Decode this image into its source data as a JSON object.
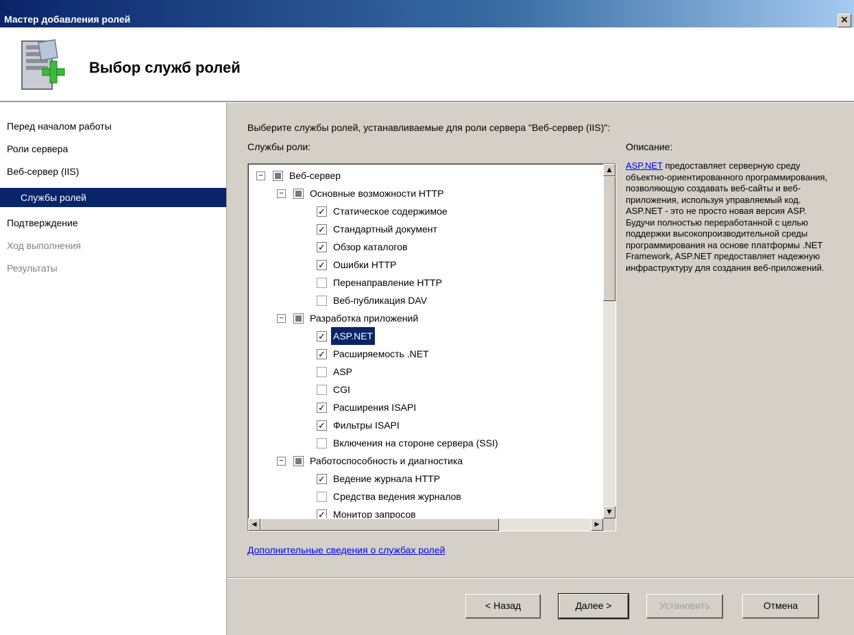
{
  "window": {
    "title": "Мастер добавления ролей",
    "close_label": "×"
  },
  "header": {
    "heading": "Выбор служб ролей"
  },
  "nav": {
    "items": [
      {
        "label": "Перед началом работы"
      },
      {
        "label": "Роли сервера"
      },
      {
        "label": "Веб-сервер (IIS)"
      },
      {
        "label": "Службы ролей"
      },
      {
        "label": "Подтверждение"
      },
      {
        "label": "Ход выполнения"
      },
      {
        "label": "Результаты"
      }
    ]
  },
  "main": {
    "instruction": "Выберите службы ролей, устанавливаемые для роли сервера \"Веб-сервер (IIS)\":",
    "roles_label": "Службы роли:",
    "description_label": "Описание:",
    "tree": [
      {
        "label": "Веб-сервер",
        "state": "partial",
        "expander": "⊟",
        "level": 0
      },
      {
        "label": "Основные возможности HTTP",
        "state": "partial",
        "expander": "⊟",
        "level": 1
      },
      {
        "label": "Статическое содержимое",
        "state": "checked",
        "level": 2
      },
      {
        "label": "Стандартный документ",
        "state": "checked",
        "level": 2
      },
      {
        "label": "Обзор каталогов",
        "state": "checked",
        "level": 2
      },
      {
        "label": "Ошибки HTTP",
        "state": "checked",
        "level": 2
      },
      {
        "label": "Перенаправление HTTP",
        "state": "unchecked",
        "level": 2
      },
      {
        "label": "Веб-публикация DAV",
        "state": "unchecked",
        "level": 2
      },
      {
        "label": "Разработка приложений",
        "state": "partial",
        "expander": "⊟",
        "level": 1
      },
      {
        "label": "ASP.NET",
        "state": "checked",
        "level": 2,
        "selected": true
      },
      {
        "label": "Расширяемость .NET",
        "state": "checked",
        "level": 2
      },
      {
        "label": "ASP",
        "state": "unchecked",
        "level": 2
      },
      {
        "label": "CGI",
        "state": "unchecked",
        "level": 2
      },
      {
        "label": "Расширения ISAPI",
        "state": "checked",
        "level": 2
      },
      {
        "label": "Фильтры ISAPI",
        "state": "checked",
        "level": 2
      },
      {
        "label": "Включения на стороне сервера (SSI)",
        "state": "unchecked",
        "level": 2
      },
      {
        "label": "Работоспособность и диагностика",
        "state": "partial",
        "expander": "⊟",
        "level": 1
      },
      {
        "label": "Ведение журнала HTTP",
        "state": "checked",
        "level": 2
      },
      {
        "label": "Средства ведения журналов",
        "state": "unchecked",
        "level": 2
      },
      {
        "label": "Монитор запросов",
        "state": "checked",
        "level": 2
      }
    ],
    "description_link": "ASP.NET",
    "description_text": " предоставляет серверную среду объектно-ориентированного программирования, позволяющую создавать веб-сайты и веб-приложения, используя управляемый код. ASP.NET - это не просто новая версия ASP. Будучи полностью переработанной с целью поддержки высокопроизводительной среды программирования на основе платформы .NET Framework, ASP.NET предоставляет надежную инфраструктуру для создания веб-приложений.",
    "more_info_link": "Дополнительные сведения о службах ролей"
  },
  "buttons": {
    "back": "< Назад",
    "next": "Далее >",
    "install": "Установить",
    "cancel": "Отмена"
  },
  "colors": {
    "selection": "#0a246a",
    "link": "#0000ee",
    "face": "#d4d0c8"
  },
  "icons": {
    "wizard": "server-add-icon",
    "check": "✓"
  }
}
